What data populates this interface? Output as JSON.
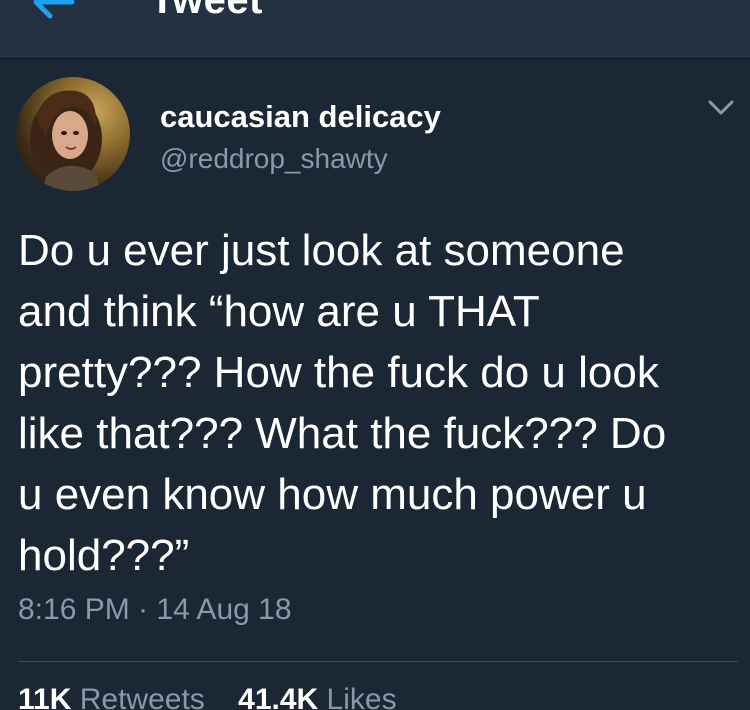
{
  "header": {
    "title": "Tweet",
    "back_icon": "back-arrow-icon"
  },
  "tweet": {
    "author": {
      "display_name": "caucasian delicacy",
      "handle": "@reddrop_shawty"
    },
    "text": "Do u ever just look at someone\nand think “how are u THAT\npretty??? How the fuck do u look\nlike that??? What the fuck??? Do\nu even know how much power u\nhold???”",
    "timestamp": "8:16 PM · 14 Aug 18",
    "stats": {
      "retweets_count": "11K",
      "retweets_label": "Retweets",
      "likes_count": "41.4K",
      "likes_label": "Likes"
    }
  },
  "colors": {
    "background": "#1c2735",
    "accent": "#1da1f2",
    "secondary_text": "#8b98a7"
  }
}
